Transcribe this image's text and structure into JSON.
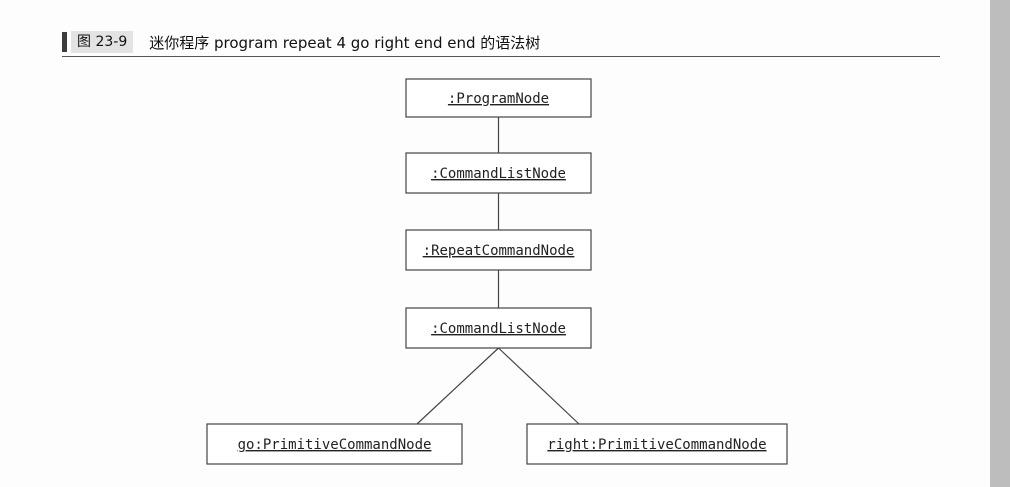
{
  "figure": {
    "number": "图 23-9",
    "caption": "迷你程序 program repeat 4 go right end end 的语法树"
  },
  "diagram": {
    "nodes": [
      {
        "id": "program",
        "label": ":ProgramNode"
      },
      {
        "id": "cmdlist1",
        "label": ":CommandListNode"
      },
      {
        "id": "repeat",
        "label": ":RepeatCommandNode"
      },
      {
        "id": "cmdlist2",
        "label": ":CommandListNode"
      },
      {
        "id": "go",
        "label": "go:PrimitiveCommandNode"
      },
      {
        "id": "right",
        "label": "right:PrimitiveCommandNode"
      }
    ],
    "edges": [
      {
        "from": "program",
        "to": "cmdlist1"
      },
      {
        "from": "cmdlist1",
        "to": "repeat"
      },
      {
        "from": "repeat",
        "to": "cmdlist2"
      },
      {
        "from": "cmdlist2",
        "to": "go"
      },
      {
        "from": "cmdlist2",
        "to": "right"
      }
    ]
  }
}
